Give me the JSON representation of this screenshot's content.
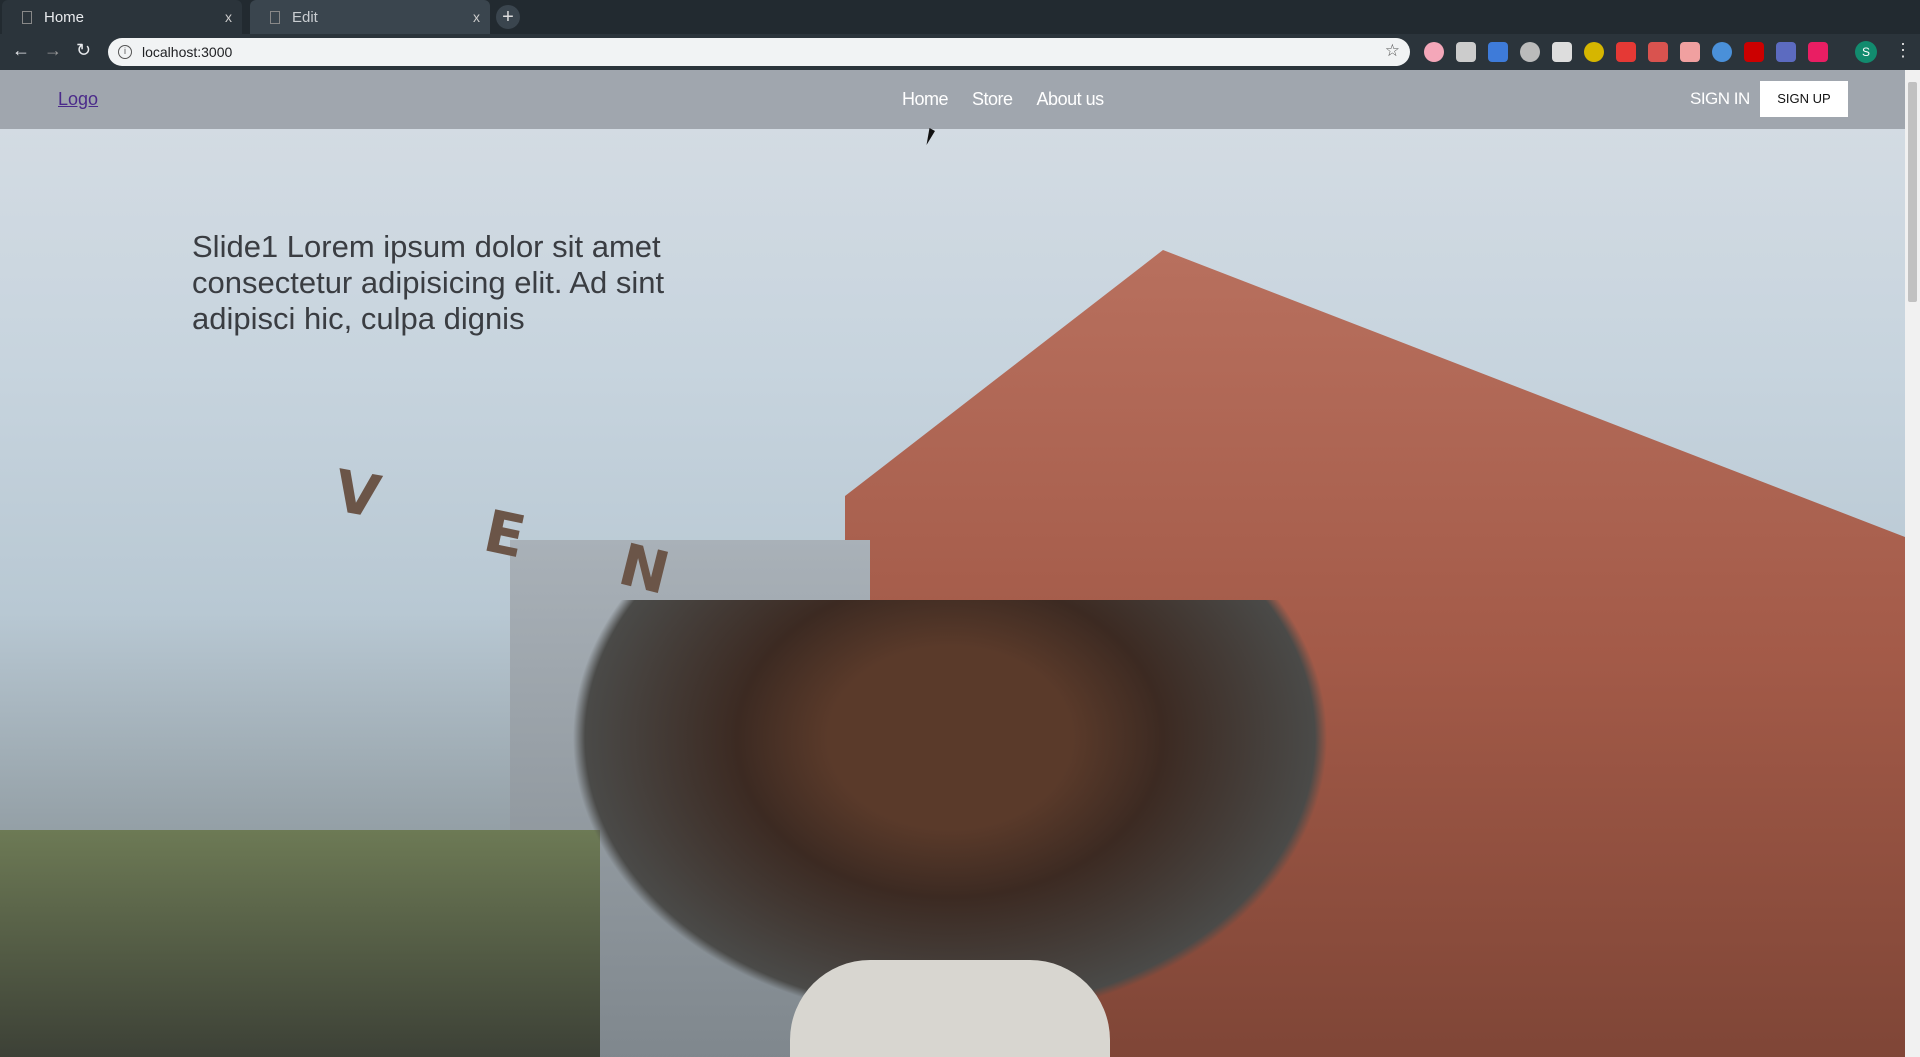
{
  "browser": {
    "tabs": [
      {
        "label": "Home",
        "close": "x"
      },
      {
        "label": "Edit",
        "close": "x"
      }
    ],
    "new_tab": "+",
    "url": "localhost:3000",
    "profile_initial": "S",
    "extension_colors": [
      "#f4a7b9",
      "#cccccc",
      "#3e7bd9",
      "#bbbbbb",
      "#dddddd",
      "#d6b600",
      "#e53935",
      "#d9534f",
      "#f0a0a0",
      "#4a90d9",
      "#cc0000",
      "#5c6bc0",
      "#e91e63"
    ]
  },
  "nav": {
    "logo": "Logo",
    "links": [
      "Home",
      "Store",
      "About us"
    ],
    "sign_in": "SIGN IN",
    "sign_up": "SIGN UP"
  },
  "hero": {
    "headline": "Slide1 Lorem ipsum dolor sit amet consectetur adipisicing elit. Ad sint adipisci hic, culpa dignis",
    "sign_letters": [
      "V",
      "E",
      "N"
    ]
  }
}
